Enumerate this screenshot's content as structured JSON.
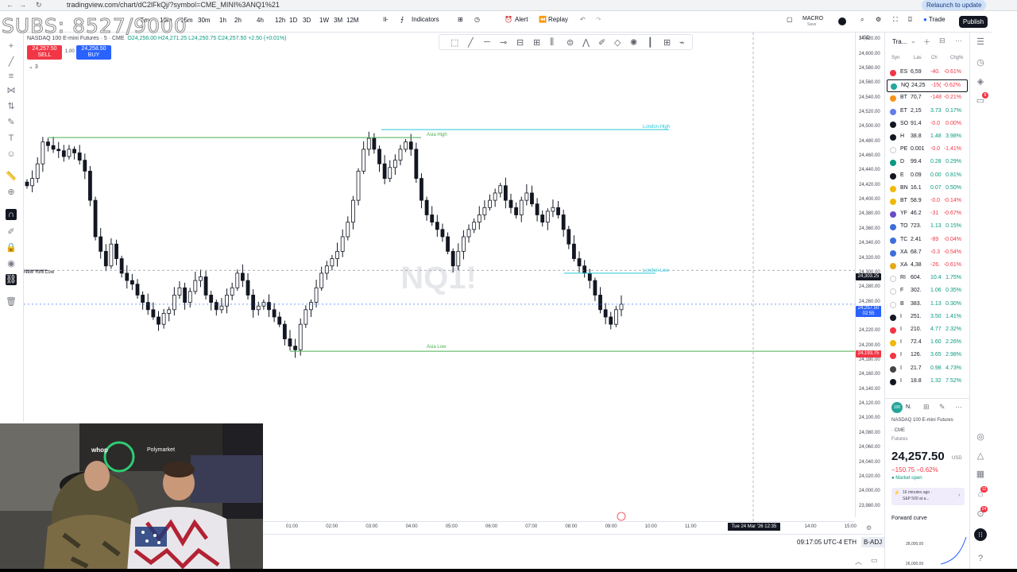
{
  "browser": {
    "url": "tradingview.com/chart/dC2lFkQj/?symbol=CME_MINI%3ANQ1%21",
    "relaunch": "Relaunch to update"
  },
  "overlay": {
    "subs_counter": "SUBS: 8527/9000"
  },
  "toolbar": {
    "timeframes": [
      "5m",
      "10m",
      "15m",
      "30m",
      "1h",
      "2h",
      "4h",
      "12h",
      "1D",
      "3D",
      "1W",
      "3M",
      "12M"
    ],
    "indicators": "Indicators",
    "alert": "Alert",
    "replay": "Replay",
    "macro": "MACRO",
    "macro_sub": "Save",
    "trade": "Trade",
    "publish": "Publish"
  },
  "symbol": {
    "line": "NASDAQ 100 E-mini Futures · 5 · CME",
    "ohlc": "O24,256.00 H24,271.25 L24,250.75 C24,257.50 +2.50 (+0.01%)",
    "sell_price": "24,257.50",
    "sell_label": "SELL",
    "buy_price": "24,258.50",
    "buy_label": "BUY",
    "spread": "1.00",
    "indicator_count": "3"
  },
  "chart": {
    "watermark": "NQ1!",
    "levels": {
      "asia_high": "Asia High",
      "london_high": "London High",
      "new_york_low": "New York Low",
      "london_low": "London Low",
      "asia_low": "Asia Low"
    },
    "up_color": "#ffffff",
    "down_color": "#131722",
    "accent": "#2962ff"
  },
  "chart_data": {
    "type": "candlestick",
    "title": "NASDAQ 100 E-mini Futures · 5 · CME",
    "ylim": [
      23960,
      24630
    ],
    "y_ticks": [
      "24,620.00",
      "24,600.00",
      "24,580.00",
      "24,560.00",
      "24,540.00",
      "24,520.00",
      "24,500.00",
      "24,480.00",
      "24,460.00",
      "24,440.00",
      "24,420.00",
      "24,400.00",
      "24,380.00",
      "24,360.00",
      "24,340.00",
      "24,320.00",
      "24,300.00",
      "24,280.00",
      "24,260.00",
      "24,240.00",
      "24,220.00",
      "24,200.00",
      "24,180.00",
      "24,160.00",
      "24,140.00",
      "24,120.00",
      "24,100.00",
      "24,080.00",
      "24,060.00",
      "24,040.00",
      "24,020.00",
      "24,000.00",
      "23,980.00"
    ],
    "x_ticks": [
      "01:00",
      "02:00",
      "03:00",
      "04:00",
      "05:00",
      "06:00",
      "07:00",
      "08:00",
      "09:00",
      "10:00",
      "11:00",
      "12:00",
      "13:00",
      "14:00",
      "15:00"
    ],
    "level_values": {
      "asia_high": 24486,
      "london_high": 24497,
      "new_york_low": 24304,
      "london_low": 24300,
      "asia_low": 24193
    },
    "closes": [
      24420,
      24430,
      24450,
      24480,
      24475,
      24470,
      24468,
      24460,
      24470,
      24465,
      24455,
      24440,
      24400,
      24350,
      24330,
      24310,
      24340,
      24320,
      24300,
      24290,
      24285,
      24270,
      24260,
      24250,
      24240,
      24230,
      24245,
      24250,
      24270,
      24280,
      24260,
      24275,
      24290,
      24295,
      24270,
      24260,
      24250,
      24255,
      24270,
      24280,
      24300,
      24290,
      24270,
      24250,
      24255,
      24260,
      24250,
      24240,
      24230,
      24210,
      24200,
      24195,
      24230,
      24250,
      24260,
      24280,
      24300,
      24310,
      24320,
      24330,
      24350,
      24370,
      24400,
      24440,
      24470,
      24485,
      24470,
      24450,
      24430,
      24445,
      24455,
      24470,
      24480,
      24470,
      24430,
      24400,
      24380,
      24370,
      24360,
      24350,
      24330,
      24310,
      24330,
      24350,
      24360,
      24370,
      24380,
      24390,
      24400,
      24410,
      24420,
      24400,
      24390,
      24380,
      24400,
      24410,
      24395,
      24380,
      24370,
      24385,
      24390,
      24380,
      24360,
      24340,
      24320,
      24310,
      24300,
      24290,
      24270,
      24250,
      24240,
      24230,
      24250,
      24257.5
    ],
    "current_price": 24257.5,
    "crosshair_price": "24,303.25",
    "current_label_time": "02:55",
    "asia_low_label": "24,193.75",
    "crosshair_time": "Tue 24 Mar '26  12:35"
  },
  "pricescale": {
    "unit": "USD"
  },
  "footer": {
    "clock": "09:17:05 UTC-4",
    "session": "ETH",
    "adj": "B-ADJ"
  },
  "watchlist": {
    "title": "Tra...",
    "cols": [
      "Syn",
      "Las",
      "Ch",
      "Chg%"
    ],
    "rows": [
      {
        "sym": "ES",
        "last": "6,59",
        "chg": "-40.",
        "pct": "-0.61%",
        "dot": "#f23645",
        "dir": "neg"
      },
      {
        "sym": "NQ",
        "last": "24,25",
        "chg": "-15(",
        "pct": "-0.62%",
        "dot": "#26a69a",
        "dir": "neg"
      },
      {
        "sym": "BT",
        "last": "70,7",
        "chg": "-148",
        "pct": "-0.21%",
        "dot": "#f7931a",
        "dir": "neg"
      },
      {
        "sym": "ET",
        "last": "2,15",
        "chg": "3.73",
        "pct": "0.17%",
        "dot": "#627eea",
        "dir": "pos"
      },
      {
        "sym": "SO",
        "last": "91.4",
        "chg": "-0.0",
        "pct": "0.00%",
        "dot": "#131722",
        "dir": "neg"
      },
      {
        "sym": "H",
        "last": "38.8",
        "chg": "1.48",
        "pct": "3.98%",
        "dot": "#131722",
        "dir": "pos"
      },
      {
        "sym": "PE",
        "last": "0.001",
        "chg": "-0.0",
        "pct": "-1.41%",
        "dot": "#ffffff",
        "dir": "neg"
      },
      {
        "sym": "D",
        "last": "99.4",
        "chg": "0.28",
        "pct": "0.29%",
        "dot": "#089981",
        "dir": "pos"
      },
      {
        "sym": "E",
        "last": "0.09",
        "chg": "0.00",
        "pct": "0.81%",
        "dot": "#131722",
        "dir": "pos"
      },
      {
        "sym": "BN",
        "last": "16.1",
        "chg": "0.07",
        "pct": "0.50%",
        "dot": "#f0b90b",
        "dir": "pos"
      },
      {
        "sym": "BT",
        "last": "58.9",
        "chg": "-0.0",
        "pct": "-0.14%",
        "dot": "#f0b90b",
        "dir": "neg"
      },
      {
        "sym": "YF",
        "last": "46.2",
        "chg": "-31",
        "pct": "-0.67%",
        "dot": "#6a4cc9",
        "dir": "neg"
      },
      {
        "sym": "TO",
        "last": "723.",
        "chg": "1.13",
        "pct": "0.15%",
        "dot": "#3d6fd8",
        "dir": "pos"
      },
      {
        "sym": "TC",
        "last": "2.41",
        "chg": "-89",
        "pct": "-0.04%",
        "dot": "#3d6fd8",
        "dir": "neg"
      },
      {
        "sym": "XA",
        "last": "68.7",
        "chg": "-0.3",
        "pct": "-0.54%",
        "dot": "#3d6fd8",
        "dir": "neg"
      },
      {
        "sym": "XA",
        "last": "4,38",
        "chg": "-26.",
        "pct": "-0.61%",
        "dot": "#e6a817",
        "dir": "neg"
      },
      {
        "sym": "RI",
        "last": "604.",
        "chg": "10.4",
        "pct": "1.75%",
        "dot": "#ffffff",
        "dir": "pos"
      },
      {
        "sym": "F",
        "last": "302.",
        "chg": "1.06",
        "pct": "0.35%",
        "dot": "#ffffff",
        "dir": "pos"
      },
      {
        "sym": "B",
        "last": "383.",
        "chg": "1.13",
        "pct": "0.30%",
        "dot": "#ffffff",
        "dir": "pos"
      },
      {
        "sym": "I",
        "last": "251.",
        "chg": "3.50",
        "pct": "1.41%",
        "dot": "#131722",
        "dir": "pos"
      },
      {
        "sym": "I",
        "last": "210.",
        "chg": "4.77",
        "pct": "2.32%",
        "dot": "#f23645",
        "dir": "pos"
      },
      {
        "sym": "I",
        "last": "72.4",
        "chg": "1.60",
        "pct": "2.26%",
        "dot": "#f0b90b",
        "dir": "pos"
      },
      {
        "sym": "I",
        "last": "126.",
        "chg": "3.65",
        "pct": "2.98%",
        "dot": "#f23645",
        "dir": "pos"
      },
      {
        "sym": "I",
        "last": "21.7",
        "chg": "0.98",
        "pct": "4.73%",
        "dot": "#444",
        "dir": "pos"
      },
      {
        "sym": "I",
        "last": "18.8",
        "chg": "1.32",
        "pct": "7.52%",
        "dot": "#131722",
        "dir": "pos"
      }
    ]
  },
  "detail": {
    "sym": "N.",
    "name": "NASDAQ 100 E-mini Futures",
    "exchange": "· CME",
    "type": "Futures",
    "price": "24,257.50",
    "currency": "USD",
    "change": "−150.75 −0.62%",
    "market": "Market open",
    "news_time": "16 minutes ago ·",
    "news_text": "S&P 500 at a...",
    "forward_curve": "Forward curve",
    "fc_ticks": [
      "28,000.00",
      "26,000.00"
    ]
  },
  "badges": {
    "alerts": "8",
    "notif1": "12",
    "notif2": "24"
  },
  "webcam": {
    "sign1": "whop",
    "sign2": "Polymarket"
  }
}
